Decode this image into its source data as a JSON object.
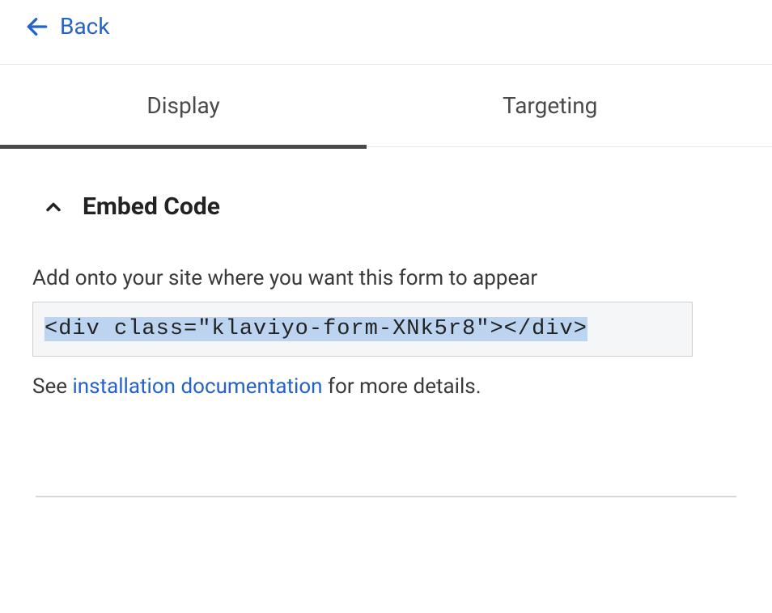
{
  "nav": {
    "back_label": "Back"
  },
  "tabs": [
    {
      "label": "Display",
      "active": true
    },
    {
      "label": "Targeting",
      "active": false
    }
  ],
  "section": {
    "title": "Embed Code",
    "description": "Add onto your site where you want this form to appear",
    "code": "<div class=\"klaviyo-form-XNk5r8\"></div>",
    "help_prefix": "See ",
    "help_link_text": "installation documentation",
    "help_suffix": " for more details."
  }
}
